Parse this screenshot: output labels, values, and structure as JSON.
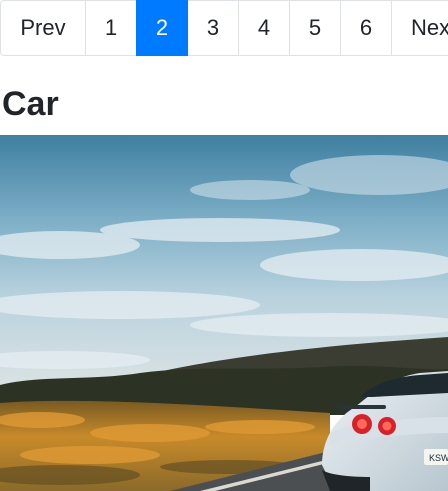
{
  "pagination": {
    "prev_label": "Prev",
    "pages": [
      "1",
      "2",
      "3",
      "4",
      "5",
      "6"
    ],
    "active_page": "2",
    "next_label": "Next"
  },
  "article": {
    "title": "Car",
    "image": {
      "subject": "sports car on a road beside a hillside at sunset",
      "plate_text": "KSW"
    }
  },
  "colors": {
    "accent": "#007bff",
    "text": "#212529",
    "border": "#dee2e6"
  }
}
